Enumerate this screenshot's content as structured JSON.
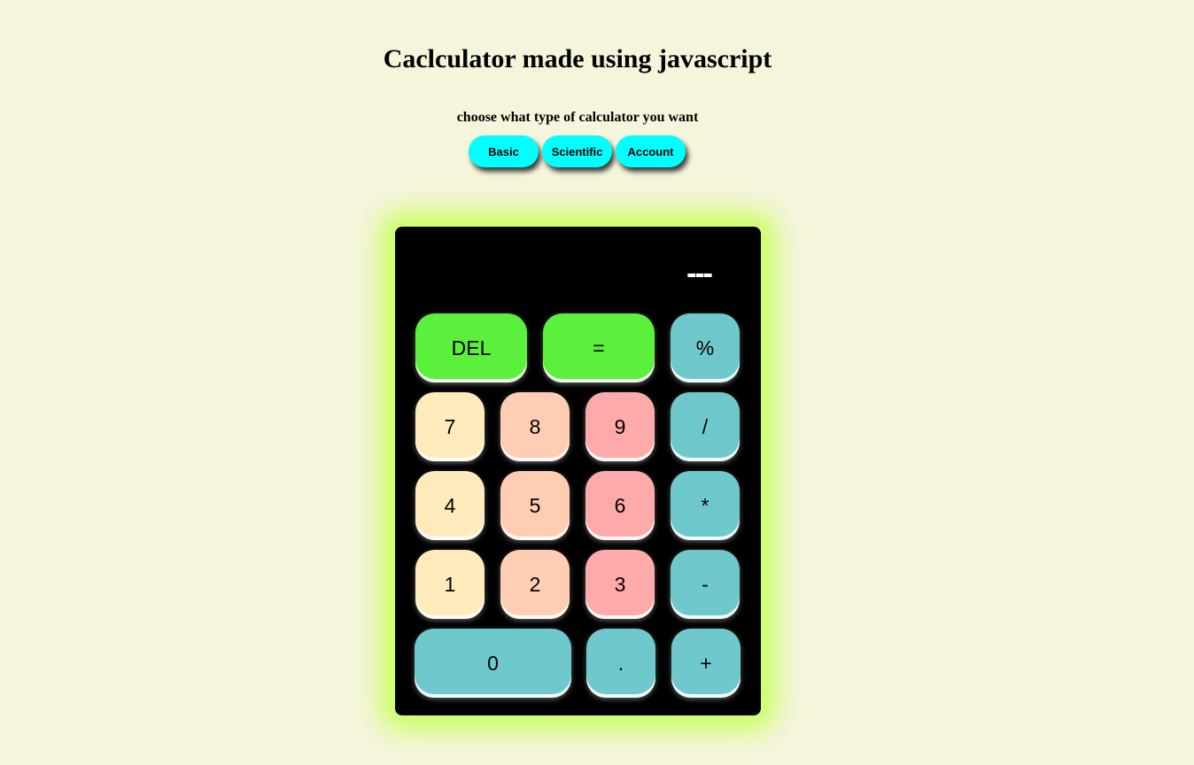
{
  "header": {
    "title": "Caclculator made using javascript",
    "prompt": "choose what type of calculator you want"
  },
  "calculator_types": [
    {
      "label": "Basic"
    },
    {
      "label": "Scientific"
    },
    {
      "label": "Account"
    }
  ],
  "display": {
    "value": "---"
  },
  "keys": {
    "del": "DEL",
    "equals": "=",
    "percent": "%",
    "seven": "7",
    "eight": "8",
    "nine": "9",
    "divide": "/",
    "four": "4",
    "five": "5",
    "six": "6",
    "multiply": "*",
    "one": "1",
    "two": "2",
    "three": "3",
    "minus": "-",
    "zero": "0",
    "dot": ".",
    "plus": "+"
  },
  "colors": {
    "page_background": "#f5f5dc",
    "type_button": "#00ffff",
    "calculator_body": "#000000",
    "glow": "#c8ff5a",
    "key_yellow": "#ffeabb",
    "key_peach": "#ffcdb3",
    "key_pink": "#ffaaaa",
    "key_teal": "#6fc8cb",
    "key_green": "#5af03c"
  }
}
